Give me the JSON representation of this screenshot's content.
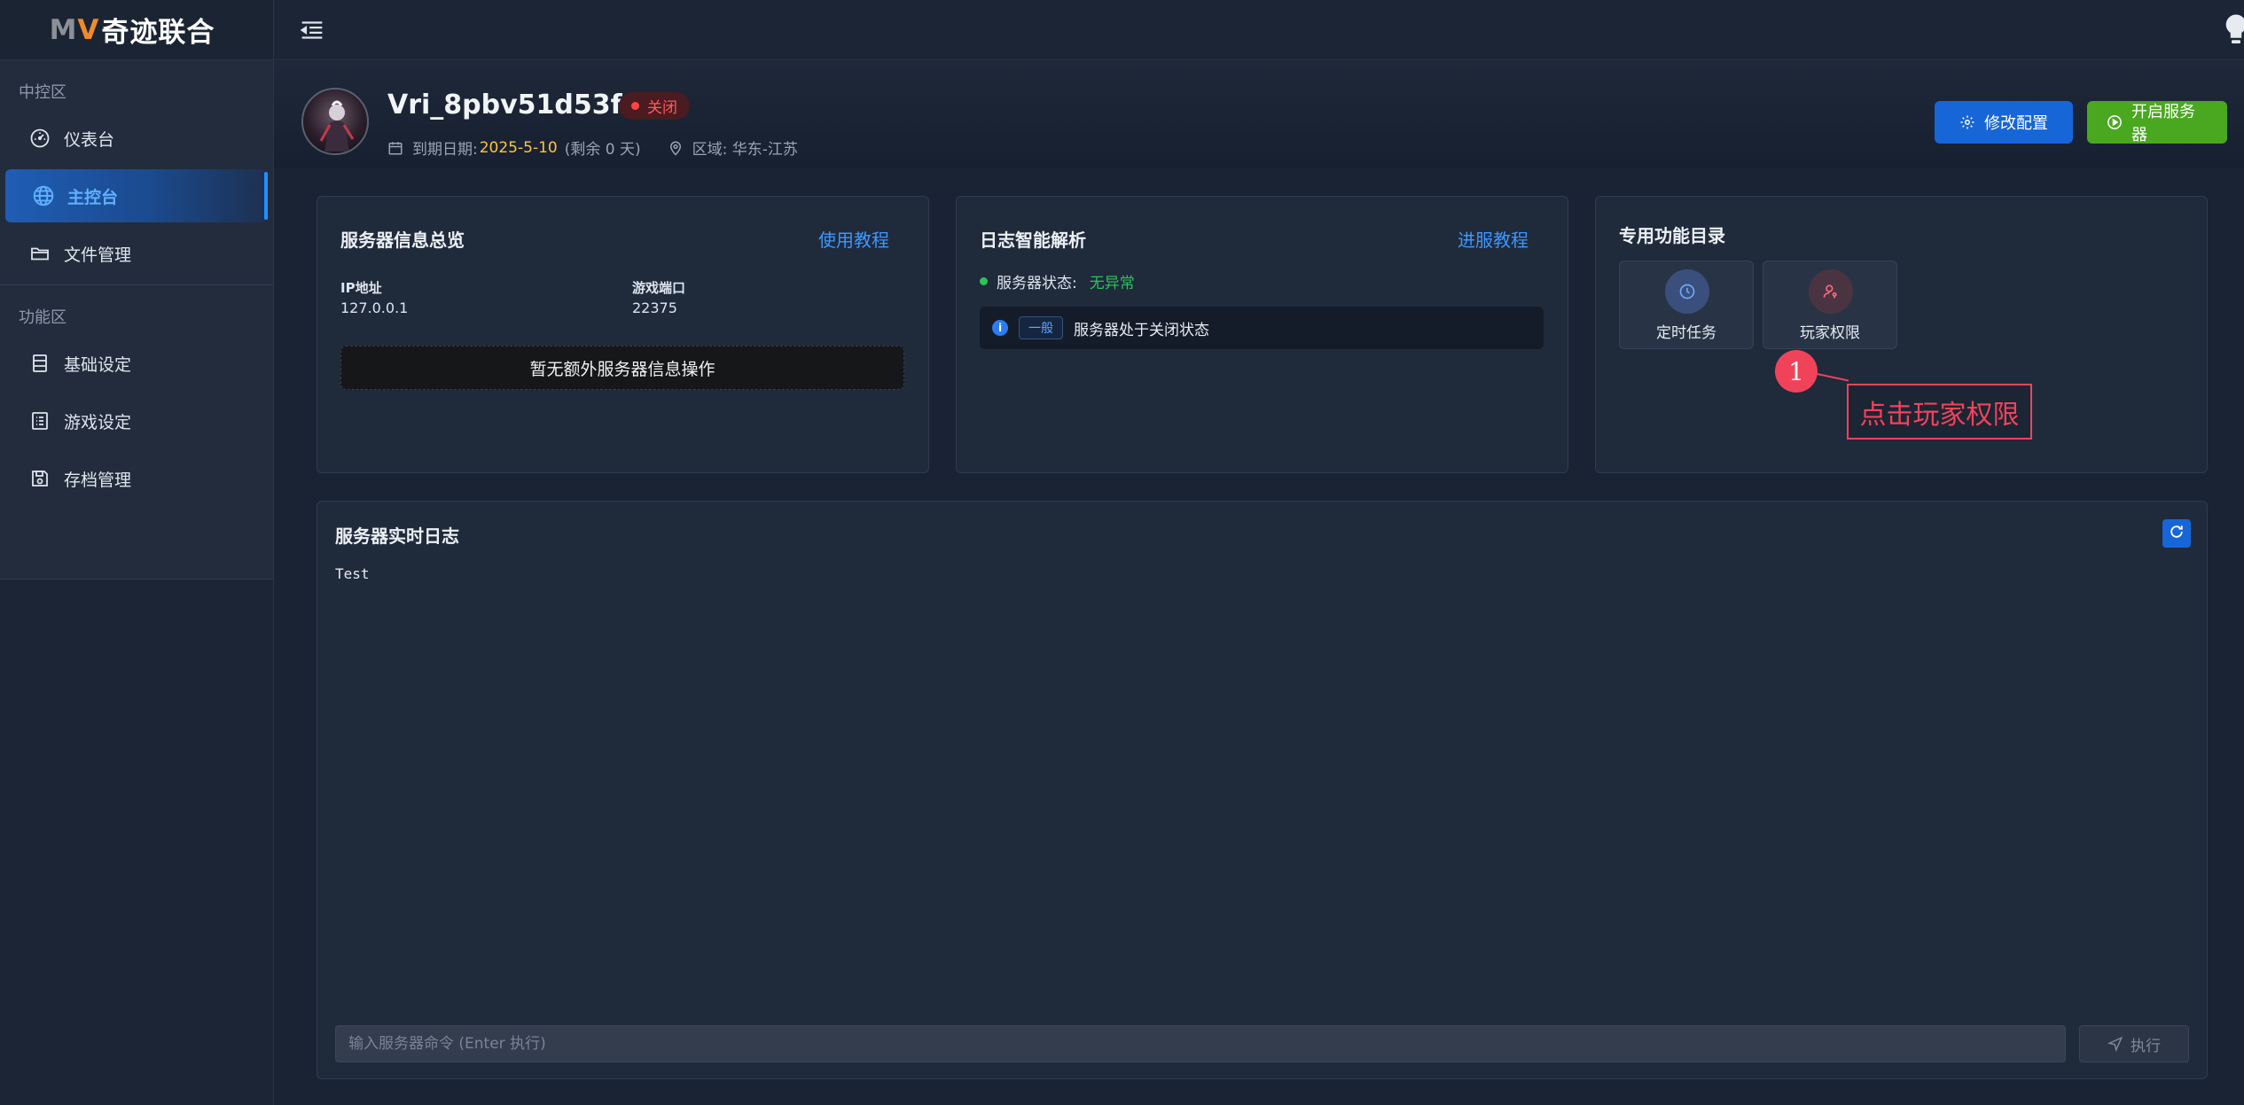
{
  "brand": {
    "logo_text": "奇迹联合",
    "logo_prefix_m": "M",
    "logo_prefix_v": "V"
  },
  "sidebar": {
    "sections": [
      {
        "label": "中控区",
        "items": [
          {
            "label": "仪表台",
            "icon": "dashboard-icon",
            "active": false
          },
          {
            "label": "主控台",
            "icon": "globe-icon",
            "active": true
          },
          {
            "label": "文件管理",
            "icon": "folder-icon",
            "active": false
          }
        ]
      },
      {
        "label": "功能区",
        "items": [
          {
            "label": "基础设定",
            "icon": "server-icon",
            "active": false
          },
          {
            "label": "游戏设定",
            "icon": "list-icon",
            "active": false
          },
          {
            "label": "存档管理",
            "icon": "save-icon",
            "active": false
          }
        ]
      }
    ]
  },
  "header": {
    "server_name": "Vri_8pbv51d53fw",
    "status": "关闭",
    "expire_label": "到期日期:",
    "expire_date": "2025-5-10",
    "remaining": "(剩余 0 天)",
    "region": "区域: 华东-江苏",
    "config_button": "修改配置",
    "start_button": "开启服务器"
  },
  "server_info": {
    "title": "服务器信息总览",
    "link": "使用教程",
    "ip_label": "IP地址",
    "ip_value": "127.0.0.1",
    "port_label": "游戏端口",
    "port_value": "22375",
    "empty_ops": "暂无额外服务器信息操作"
  },
  "log_analysis": {
    "title": "日志智能解析",
    "link": "进服教程",
    "status_label": "服务器状态:",
    "status_value": "无异常",
    "entry_tag": "一般",
    "entry_message": "服务器处于关闭状态"
  },
  "functions": {
    "title": "专用功能目录",
    "tiles": [
      {
        "label": "定时任务",
        "icon": "clock-icon"
      },
      {
        "label": "玩家权限",
        "icon": "user-key-icon"
      }
    ]
  },
  "annotation": {
    "number": "1",
    "text": "点击玩家权限"
  },
  "realtime_log": {
    "title": "服务器实时日志",
    "content": "Test",
    "input_placeholder": "输入服务器命令 (Enter 执行)",
    "execute_button": "执行"
  },
  "colors": {
    "accent": "#1766d8",
    "start": "#49a81f",
    "danger": "#ff4444",
    "ok": "#2dc35a",
    "warning": "#ffc53d",
    "annotation": "#f0435a"
  }
}
